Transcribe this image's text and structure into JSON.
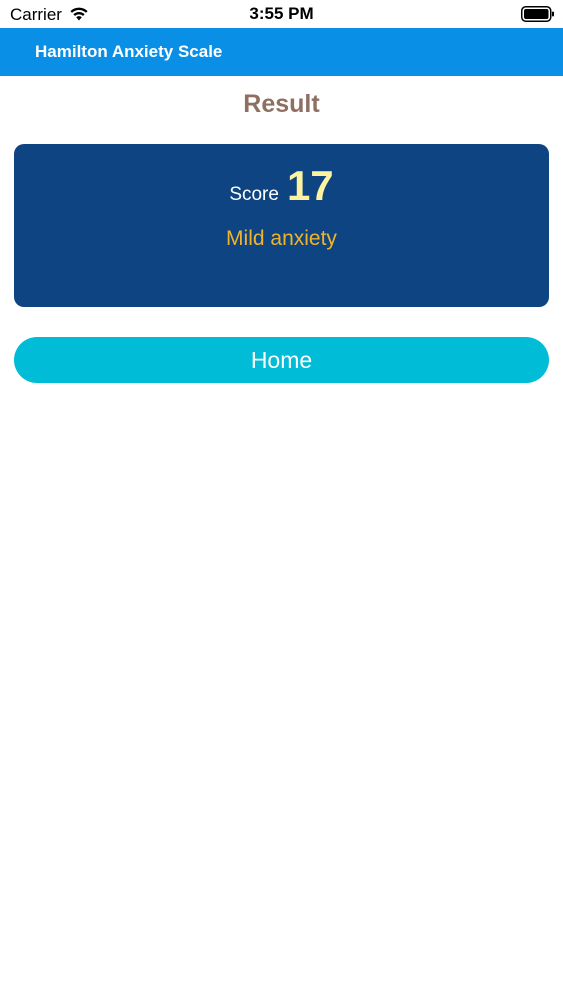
{
  "status_bar": {
    "carrier": "Carrier",
    "time": "3:55 PM",
    "wifi_icon": "wifi-icon",
    "battery_icon": "battery-icon"
  },
  "app_bar": {
    "title": "Hamilton Anxiety Scale"
  },
  "page": {
    "title": "Result"
  },
  "result": {
    "score_label": "Score",
    "score_value": "17",
    "description": "Mild anxiety"
  },
  "actions": {
    "home_label": "Home"
  },
  "colors": {
    "app_bar": "#0a8fe6",
    "card": "#0f4482",
    "score_value": "#fbf3a0",
    "description": "#f0b429",
    "home_button": "#00bcd6",
    "title": "#8e6f62"
  }
}
